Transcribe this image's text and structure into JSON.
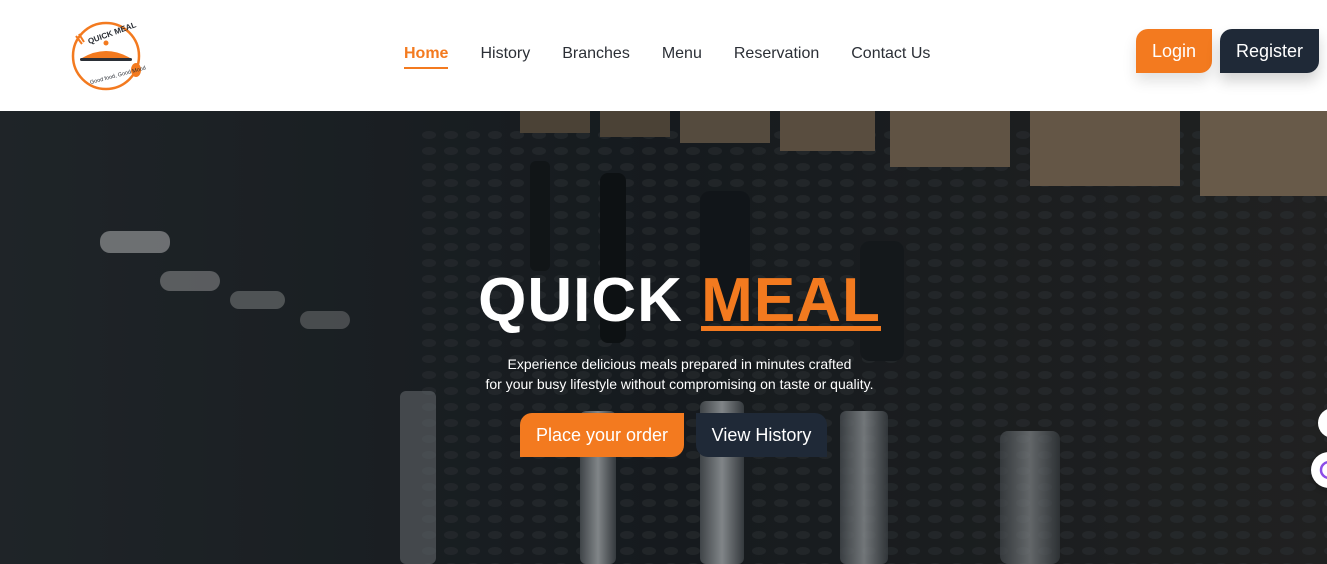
{
  "brand": {
    "logo_title": "QUICK MEAL",
    "logo_tagline": "Good food, Good Mood"
  },
  "nav": {
    "items": [
      {
        "label": "Home",
        "active": true
      },
      {
        "label": "History",
        "active": false
      },
      {
        "label": "Branches",
        "active": false
      },
      {
        "label": "Menu",
        "active": false
      },
      {
        "label": "Reservation",
        "active": false
      },
      {
        "label": "Contact Us",
        "active": false
      }
    ]
  },
  "auth": {
    "login_label": "Login",
    "register_label": "Register"
  },
  "hero": {
    "title_main": "QUICK",
    "title_accent": "MEAL",
    "subtitle_line1": "Experience delicious meals prepared in minutes crafted",
    "subtitle_line2": "for your busy lifestyle without compromising on taste or quality.",
    "primary_button": "Place your order",
    "secondary_button": "View History"
  },
  "colors": {
    "accent": "#f37a1f",
    "dark": "#1f2937",
    "text": "#2b2f36"
  }
}
